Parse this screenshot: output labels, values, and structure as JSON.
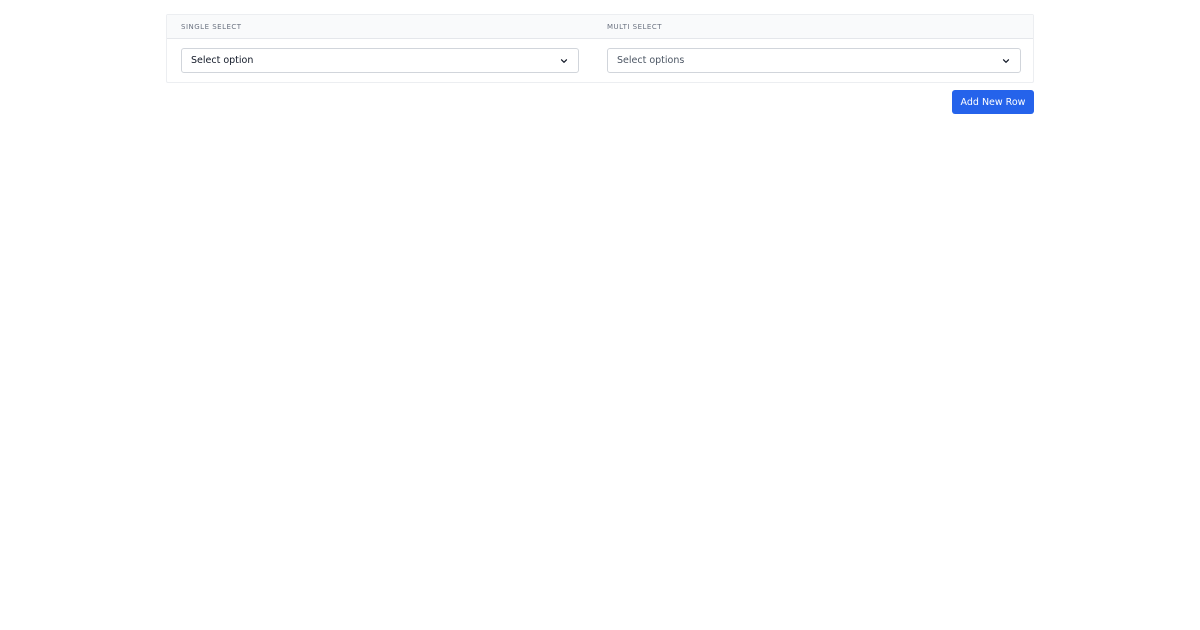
{
  "table": {
    "columns": [
      {
        "label": "SINGLE SELECT"
      },
      {
        "label": "MULTI SELECT"
      }
    ],
    "rows": [
      {
        "single_select": {
          "value": "Select option",
          "icon": "chevron-down-icon"
        },
        "multi_select": {
          "placeholder": "Select options",
          "icon": "chevron-down-icon"
        }
      }
    ]
  },
  "actions": {
    "add_row_label": "Add New Row"
  },
  "colors": {
    "primary": "#2563eb",
    "header_bg": "#f9fafb",
    "border": "#d1d5db"
  }
}
